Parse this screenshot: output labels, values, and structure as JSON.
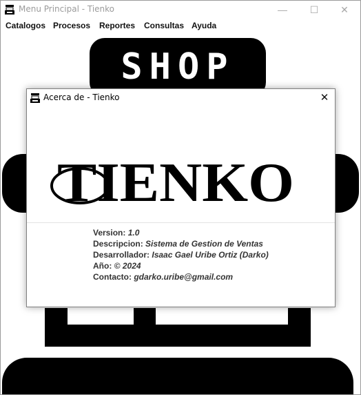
{
  "window": {
    "title": "Menu Principal - Tienko",
    "minimize_glyph": "—",
    "maximize_glyph": "☐",
    "close_glyph": "✕"
  },
  "menu": {
    "items": [
      {
        "label": "Catalogos"
      },
      {
        "label": "Procesos"
      },
      {
        "label": "Reportes"
      },
      {
        "label": "Consultas"
      },
      {
        "label": "Ayuda"
      }
    ]
  },
  "background": {
    "shop_sign_text": "SHOP"
  },
  "dialog": {
    "title": "Acerca de - Tienko",
    "close_glyph": "✕",
    "logo_text": "TIENKO",
    "info": [
      {
        "label": "Version:",
        "value": "1.0"
      },
      {
        "label": "Descripcion:",
        "value": "Sistema de Gestion de Ventas"
      },
      {
        "label": "Desarrollador:",
        "value": "Isaac Gael Uribe Ortiz (Darko)"
      },
      {
        "label": "Año:",
        "value": "© 2024"
      },
      {
        "label": "Contacto:",
        "value": "gdarko.uribe@gmail.com"
      }
    ]
  },
  "colors": {
    "titlebar_text": "#9b9b9b",
    "accent_black": "#000000"
  }
}
